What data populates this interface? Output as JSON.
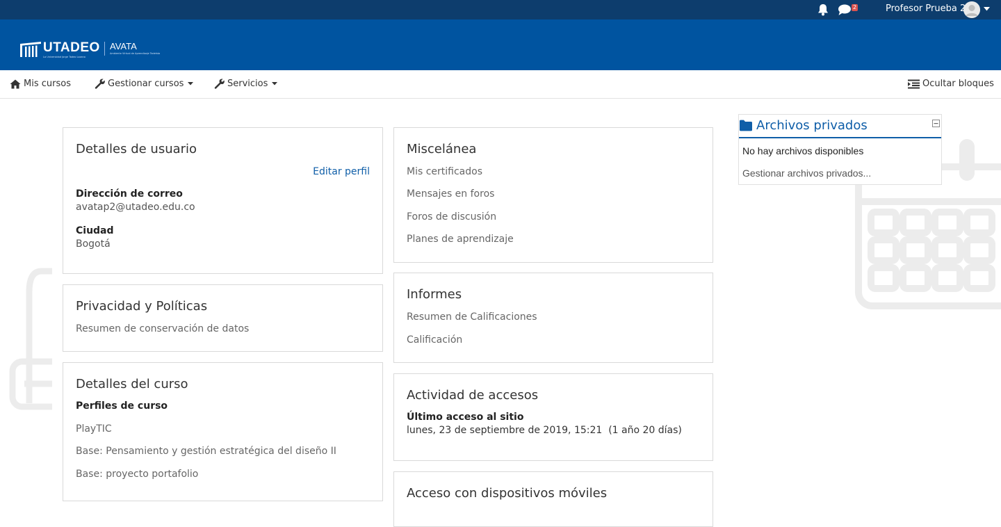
{
  "topbar": {
    "notification_count": "2",
    "username": "Profesor Prueba 2"
  },
  "header": {
    "logo_text": "UTADEO",
    "logo_sub": "La Universidad Jorge Tadeo Lozano",
    "app_name": "AVATA",
    "app_sub": "Ambiente Virtual de Aprendizaje Tadeísta"
  },
  "nav": {
    "my_courses": "Mis cursos",
    "manage_courses": "Gestionar cursos",
    "services": "Servicios",
    "hide_blocks": "Ocultar bloques"
  },
  "user_details": {
    "title": "Detalles de usuario",
    "edit_profile": "Editar perfil",
    "email_label": "Dirección de correo",
    "email_value": "avatap2@utadeo.edu.co",
    "city_label": "Ciudad",
    "city_value": "Bogotá"
  },
  "privacy": {
    "title": "Privacidad y Políticas",
    "retention": "Resumen de conservación de datos"
  },
  "course_details": {
    "title": "Detalles del curso",
    "profiles_label": "Perfiles de curso",
    "courses": [
      "PlayTIC",
      "Base: Pensamiento y gestión estratégica del diseño II",
      "Base: proyecto portafolio"
    ]
  },
  "misc": {
    "title": "Miscelánea",
    "links": [
      "Mis certificados",
      "Mensajes en foros",
      "Foros de discusión",
      "Planes de aprendizaje"
    ]
  },
  "reports": {
    "title": "Informes",
    "links": [
      "Resumen de Calificaciones",
      "Calificación"
    ]
  },
  "access": {
    "title": "Actividad de accesos",
    "last_access_label": "Último acceso al sitio",
    "last_access_value": "lunes, 23 de septiembre de 2019, 15:21  (1 año 20 días)"
  },
  "mobile": {
    "title": "Acceso con dispositivos móviles"
  },
  "private_files": {
    "title": "Archivos privados",
    "empty": "No hay archivos disponibles",
    "manage": "Gestionar archivos privados..."
  },
  "colors": {
    "topbar": "#0d3d6d",
    "header": "#0054a0",
    "link": "#0f5ea8",
    "badge": "#d9534f"
  }
}
